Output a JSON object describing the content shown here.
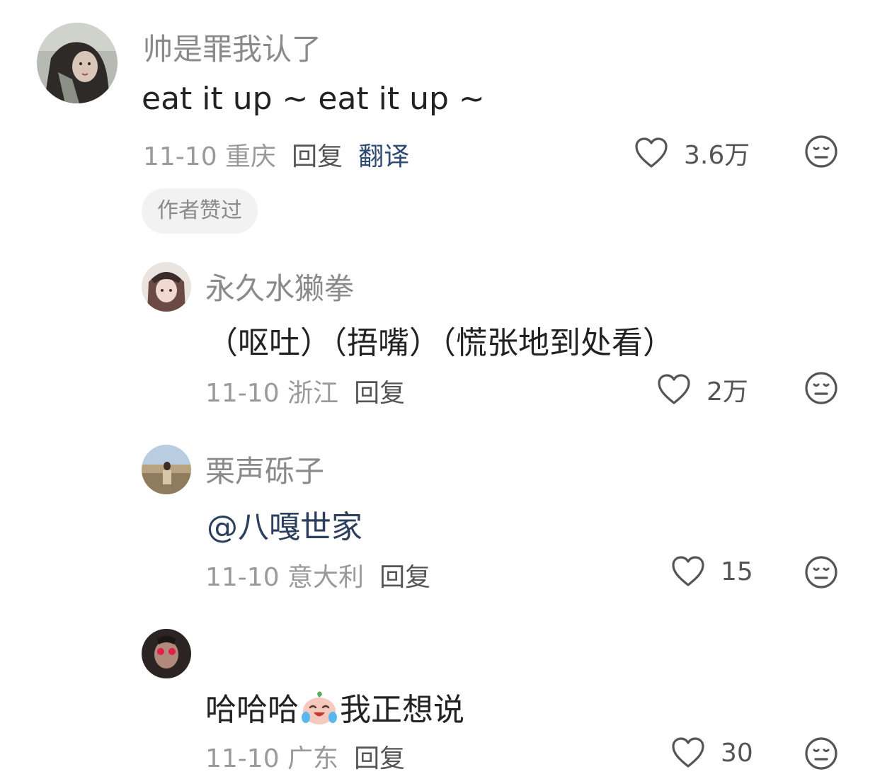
{
  "comments": [
    {
      "username": "帅是罪我认了",
      "text": "eat it up  ~ eat it up ~",
      "date_location": "11-10 重庆",
      "reply_label": "回复",
      "translate_label": "翻译",
      "like_count": "3.6万",
      "author_tag": "作者赞过"
    },
    {
      "username": "永久水獭拳",
      "text": "（呕吐）（捂嘴）（慌张地到处看）",
      "date_location": "11-10 浙江",
      "reply_label": "回复",
      "like_count": "2万"
    },
    {
      "username": "栗声砾子",
      "text": "@八嘎世家",
      "date_location": "11-10 意大利",
      "reply_label": "回复",
      "like_count": "15"
    },
    {
      "username": "",
      "text_before": "哈哈哈",
      "emoji_icon": "crying-laughing-peach-emoji",
      "text_after": "我正想说",
      "date_location": "11-10 广东",
      "reply_label": "回复",
      "like_count": "30"
    }
  ],
  "icons": {
    "like": "heart-outline-icon",
    "dislike": "unamused-face-icon"
  },
  "colors": {
    "username": "#8a8a8a",
    "text": "#222222",
    "meta": "#9a9a9a",
    "reply": "#555555",
    "link": "#2e4a73",
    "tag_bg": "#f2f2f2"
  }
}
